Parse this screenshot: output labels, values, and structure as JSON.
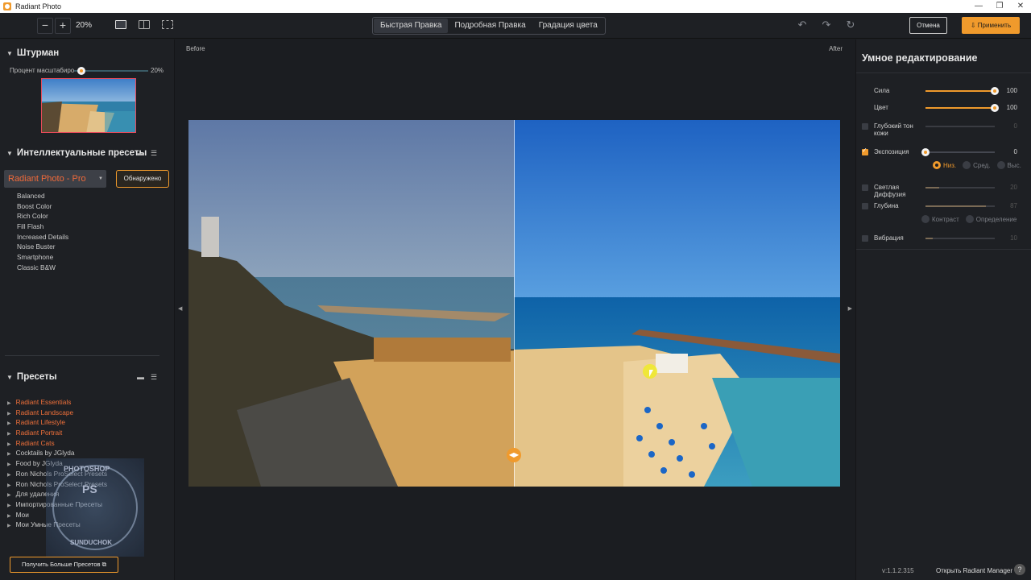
{
  "window": {
    "title": "Radiant Photo",
    "controls": [
      "—",
      "❐",
      "✕"
    ]
  },
  "toolbar": {
    "zoom_out": "−",
    "zoom_in": "+",
    "zoom_value": "20%",
    "tabs": [
      {
        "label": "Быстрая Правка",
        "active": true
      },
      {
        "label": "Подробная Правка",
        "active": false
      },
      {
        "label": "Градация цвета",
        "active": false
      }
    ],
    "undo": "↶",
    "redo": "↷",
    "reset": "↻",
    "cancel_label": "Отмена",
    "apply_label": "⇩ Применить"
  },
  "left": {
    "navigator": {
      "title": "Штурман",
      "zoom_label": "Процент масштабирования",
      "zoom_value": "20%",
      "zoom_level": 0.04
    },
    "smart_presets": {
      "title": "Интеллектуальные пресеты",
      "selected": "Radiant Photo - Pro",
      "detected_label": "Обнаружено",
      "items": [
        "Balanced",
        "Boost Color",
        "Rich Color",
        "Fill Flash",
        "Increased Details",
        "Noise Buster",
        "Smartphone",
        "Classic B&W"
      ]
    },
    "presets": {
      "title": "Пресеты",
      "items": [
        {
          "label": "Radiant Essentials",
          "highlight": true
        },
        {
          "label": "Radiant Landscape",
          "highlight": true
        },
        {
          "label": "Radiant Lifestyle",
          "highlight": true
        },
        {
          "label": "Radiant Portrait",
          "highlight": true
        },
        {
          "label": "Radiant Cats",
          "highlight": true
        },
        {
          "label": "Cocktails by JGlyda",
          "highlight": false
        },
        {
          "label": "Food by JGlyda",
          "highlight": false
        },
        {
          "label": "Ron Nichols ProSelect Presets",
          "highlight": false
        },
        {
          "label": "Ron Nichols ProSelect Presets",
          "highlight": false
        },
        {
          "label": "Для удаления",
          "highlight": false
        },
        {
          "label": "Импортированные Пресеты",
          "highlight": false
        },
        {
          "label": "Мои",
          "highlight": false
        },
        {
          "label": "Мои Умные Пресеты",
          "highlight": false
        }
      ],
      "get_more_label": "Получить Больше Пресетов"
    },
    "watermark": {
      "top": "PHOTOSHOP",
      "center": "PS",
      "bottom": "SUNDUCHOK"
    }
  },
  "canvas": {
    "before_label": "Before",
    "after_label": "After",
    "split_position": 0.5
  },
  "right": {
    "title": "Умное редактирование",
    "sliders": [
      {
        "label": "Сила",
        "value": "100",
        "level": 1.0,
        "checkbox": null,
        "enabled": true
      },
      {
        "label": "Цвет",
        "value": "100",
        "level": 1.0,
        "checkbox": null,
        "enabled": true
      },
      {
        "label": "Глубокий тон кожи",
        "value": "0",
        "level": 0.0,
        "checkbox": false,
        "enabled": false
      },
      {
        "label": "Экспозиция",
        "value": "0",
        "level": 0.0,
        "checkbox": true,
        "enabled": true
      },
      {
        "label": "Светлая Диффузия",
        "value": "20",
        "level": 0.2,
        "checkbox": false,
        "enabled": false
      },
      {
        "label": "Глубина",
        "value": "87",
        "level": 0.87,
        "checkbox": false,
        "enabled": false
      },
      {
        "label": "Вибрация",
        "value": "10",
        "level": 0.1,
        "checkbox": false,
        "enabled": false
      }
    ],
    "exposure_options": [
      {
        "label": "Низ.",
        "selected": true
      },
      {
        "label": "Сред.",
        "selected": false
      },
      {
        "label": "Выс.",
        "selected": false
      }
    ],
    "depth_options": [
      {
        "label": "Контраст",
        "selected": false
      },
      {
        "label": "Определение",
        "selected": false
      }
    ],
    "version": "v:1.1.2.315",
    "manager_label": "Открыть Radiant Manager",
    "help": "?"
  },
  "colors": {
    "accent": "#f09a2c",
    "preset_highlight": "#f0703a",
    "background": "#1b1d21",
    "panel": "#1e2024"
  }
}
